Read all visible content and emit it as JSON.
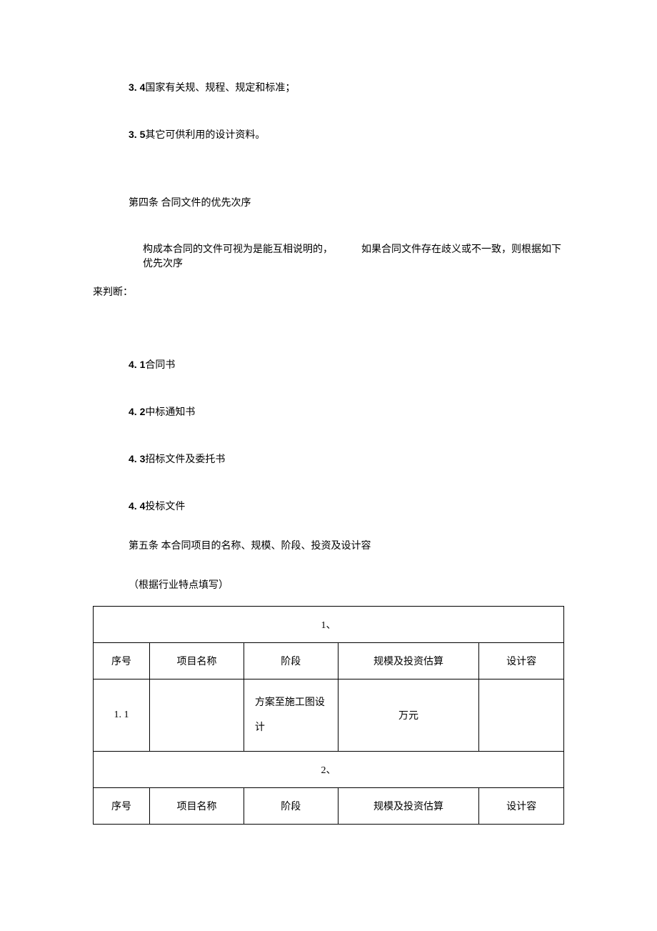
{
  "paragraphs": {
    "p1": {
      "num": "3. 4",
      "text": "国家有关规、规程、规定和标准；"
    },
    "p2": {
      "num": "3. 5",
      "text": "其它可供利用的设计资料。"
    },
    "section4_title": "第四条  合同文件的优先次序",
    "section4_body_a": "构成本合同的文件可视为是能互相说明的，",
    "section4_body_b": "如果合同文件存在歧义或不一致，则根据如下优先次序",
    "section4_body_c": "来判断：",
    "p3": {
      "num": "4. 1",
      "text": "合同书"
    },
    "p4": {
      "num": "4. 2",
      "text": "中标通知书"
    },
    "p5": {
      "num": "4. 3",
      "text": "招标文件及委托书"
    },
    "p6": {
      "num": "4. 4",
      "text": "投标文件"
    },
    "section5_title": "第五条  本合同项目的名称、规模、阶段、投资及设计容",
    "section5_note": "（根据行业特点填写）"
  },
  "table": {
    "group1_header": "1、",
    "group2_header": "2、",
    "headers": {
      "c1": "序号",
      "c2": "项目名称",
      "c3": "阶段",
      "c4": "规模及投资估算",
      "c5": "设计容"
    },
    "row1": {
      "c1": "1. 1",
      "c2": "",
      "c3": "方案至施工图设计",
      "c4": "万元",
      "c5": ""
    }
  }
}
